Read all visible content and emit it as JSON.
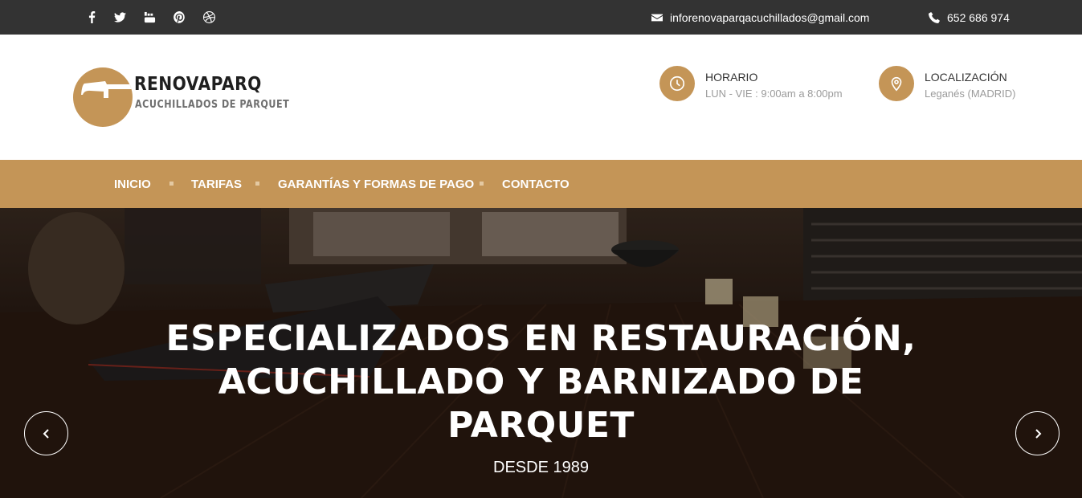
{
  "topbar": {
    "social": [
      {
        "icon": "facebook-icon"
      },
      {
        "icon": "twitter-icon"
      },
      {
        "icon": "youtube-icon"
      },
      {
        "icon": "pinterest-icon"
      },
      {
        "icon": "dribbble-icon"
      }
    ],
    "email": "inforenovaparqacuchillados@gmail.com",
    "phone": "652 686 974"
  },
  "header": {
    "logo_title": "RENOVAPARQ",
    "logo_subtitle": "ACUCHILLADOS DE PARQUET",
    "horario": {
      "title": "HORARIO",
      "text": "LUN - VIE : 9:00am a 8:00pm"
    },
    "localizacion": {
      "title": "LOCALIZACIÓN",
      "text": "Leganés (MADRID)"
    }
  },
  "nav": {
    "items": [
      "INICIO",
      "TARIFAS",
      "GARANTÍAS Y FORMAS DE PAGO",
      "CONTACTO"
    ]
  },
  "hero": {
    "title_lines": [
      "ESPECIALIZADOS EN RESTAURACIÓN,",
      "ACUCHILLADO Y BARNIZADO DE",
      "PARQUET"
    ],
    "subtitle": "DESDE 1989"
  },
  "colors": {
    "accent": "#c49557",
    "topbar": "#333333"
  }
}
